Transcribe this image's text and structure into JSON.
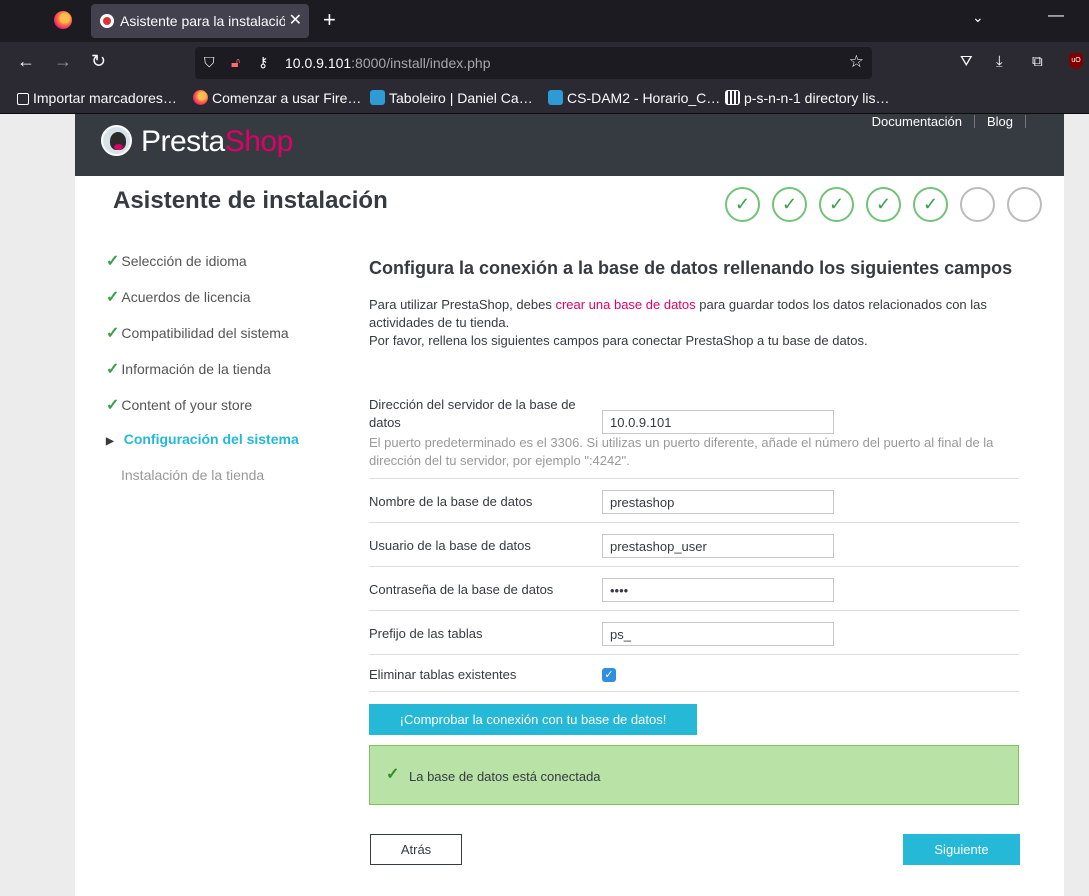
{
  "browser": {
    "tab_title": "Asistente para la instalación",
    "url_host": "10.0.9.101",
    "url_path": ":8000/install/index.php",
    "bookmarks": [
      "Importar marcadores…",
      "Comenzar a usar Fire…",
      "Taboleiro | Daniel Ca…",
      "CS-DAM2 - Horario_C…",
      "p-s-n-n-1 directory lis…"
    ],
    "ublock_label": "uO"
  },
  "header": {
    "logo_presta": "Presta",
    "logo_shop": "Shop",
    "links": [
      "Documentación",
      "Blog"
    ]
  },
  "wizard": {
    "title": "Asistente de instalación",
    "steps_completed": 5,
    "steps_total": 7
  },
  "sidebar": {
    "items": [
      {
        "label": "Selección de idioma",
        "state": "done"
      },
      {
        "label": "Acuerdos de licencia",
        "state": "done"
      },
      {
        "label": "Compatibilidad del sistema",
        "state": "done"
      },
      {
        "label": "Información de la tienda",
        "state": "done"
      },
      {
        "label": "Content of your store",
        "state": "done"
      },
      {
        "label": "Configuración del sistema",
        "state": "active"
      },
      {
        "label": "Instalación de la tienda",
        "state": "pending"
      }
    ]
  },
  "content": {
    "title": "Configura la conexión a la base de datos rellenando los siguientes campos",
    "intro_before_link": "Para utilizar PrestaShop, debes ",
    "intro_link": "crear una base de datos",
    "intro_after_link": " para guardar todos los datos relacionados con las actividades de tu tienda.",
    "intro_line2": "Por favor, rellena los siguientes campos para conectar PrestaShop a tu base de datos."
  },
  "form": {
    "server_label": "Dirección del servidor de la base de datos",
    "server_value": "10.0.9.101",
    "server_hint": "El puerto predeterminado es el 3306. Si utilizas un puerto diferente, añade el número del puerto al final de la dirección del tu servidor, por ejemplo \":4242\".",
    "dbname_label": "Nombre de la base de datos",
    "dbname_value": "prestashop",
    "user_label": "Usuario de la base de datos",
    "user_value": "prestashop_user",
    "password_label": "Contraseña de la base de datos",
    "password_value": "••••",
    "prefix_label": "Prefijo de las tablas",
    "prefix_value": "ps_",
    "drop_label": "Eliminar tablas existentes",
    "drop_checked": true,
    "check_button": "¡Comprobar la conexión con tu base de datos!",
    "success_message": "La base de datos está conectada"
  },
  "nav": {
    "back": "Atrás",
    "next": "Siguiente"
  },
  "colors": {
    "accent": "#25b9d7",
    "brand_pink": "#df0067",
    "header_bg": "#363a41",
    "success_bg": "#b9e2a6"
  }
}
